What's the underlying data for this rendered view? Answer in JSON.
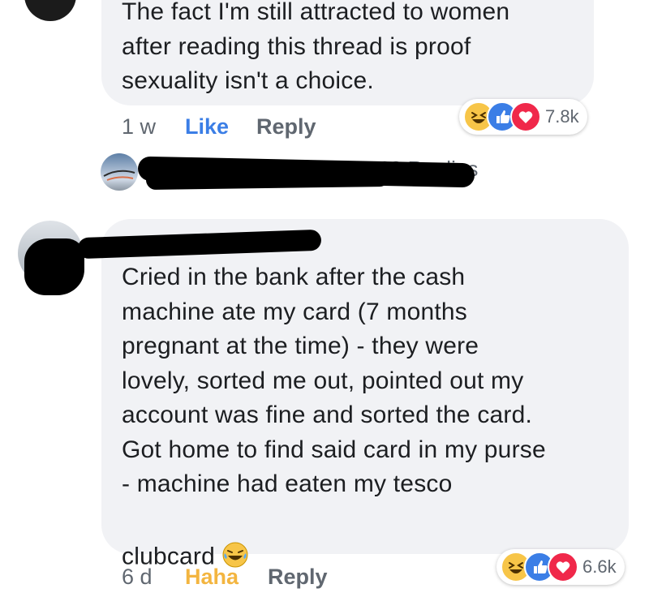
{
  "comment1": {
    "text": "The fact I'm still attracted to women\nafter reading this thread is proof\nsexuality isn't a choice.",
    "time": "1 w",
    "like_label": "Like",
    "reply_label": "Reply",
    "reaction_count": "7.8k",
    "replies_label": "168 Replies"
  },
  "comment2": {
    "text": "Cried in the bank after the cash\nmachine ate my card (7 months\npregnant at the time) - they were\nlovely, sorted me out, pointed out my\naccount was fine and sorted the card.\nGot home to find said card in my purse\n- machine had eaten my tesco\nclubcard",
    "time": "6 d",
    "reaction_label": "Haha",
    "reply_label": "Reply",
    "reaction_count": "6.6k"
  },
  "icons": [
    "haha-icon",
    "like-icon",
    "love-icon",
    "laughing-tears-emoji"
  ],
  "colors": {
    "bubble": "#f1f2f5",
    "like_blue": "#3b7ee6",
    "haha_yellow": "#f3b540",
    "love_red": "#f0284a",
    "muted": "#606770"
  }
}
